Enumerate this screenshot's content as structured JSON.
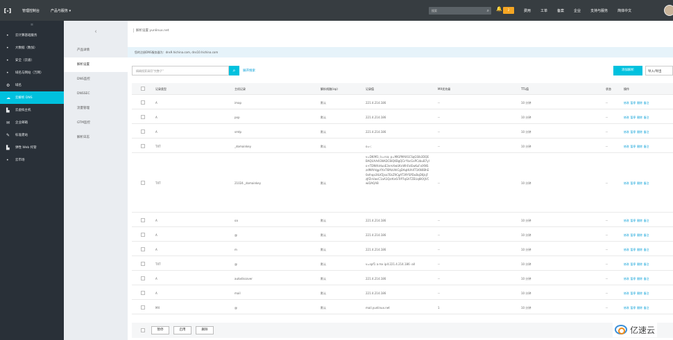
{
  "topbar": {
    "logo": "[-]",
    "console": "管理控制台",
    "products": "产品与服务 ▾",
    "search_placeholder": "搜索",
    "search_icon": "search-icon",
    "bell_icon": "bell-icon",
    "badge": "2",
    "links": [
      "费用",
      "工单",
      "备案",
      "企业",
      "支持与服务",
      "简体中文"
    ]
  },
  "sidebar": {
    "collapse": "≡",
    "items": [
      {
        "label": "云计算基础服务",
        "icon": "•"
      },
      {
        "label": "大数据（数加）",
        "icon": "•"
      },
      {
        "label": "安全（云盾）",
        "icon": "•"
      },
      {
        "label": "域名与网站（万网）",
        "icon": "•"
      },
      {
        "label": "域名",
        "icon": "⚙"
      },
      {
        "label": "云解析 DNS",
        "icon": "☁"
      },
      {
        "label": "云虚拟主机",
        "icon": "▙"
      },
      {
        "label": "企业邮箱",
        "icon": "✉"
      },
      {
        "label": "标准建站",
        "icon": "✎"
      },
      {
        "label": "弹性 Web 托管",
        "icon": "▙"
      },
      {
        "label": "云市场",
        "icon": "•"
      }
    ],
    "active_index": 5
  },
  "subnav": {
    "back": "‹",
    "items": [
      "产品详情",
      "解析设置",
      "DNS监控",
      "DNSSEC",
      "流量管理",
      "GTM监控",
      "解析日志"
    ],
    "active_index": 1
  },
  "main": {
    "breadcrumb": "解析设置 yunlinux.net",
    "notice": "您的注册DNS服务器为：dns9.hichina.com, dns10.hichina.com",
    "search_placeholder": "精确搜索请用\"完整子\"",
    "advanced": "展开搜索",
    "add_button": "添加解析",
    "import_button": "导入/导出"
  },
  "table": {
    "headers": [
      "记录类型",
      "主机记录",
      "解析线路(isp)",
      "记录值",
      "MX优先级",
      "TTL值",
      "状态",
      "操作"
    ],
    "ops": [
      "修改",
      "暂停",
      "删除",
      "备注"
    ],
    "rows": [
      {
        "type": "A",
        "host": "imap",
        "line": "默认",
        "value": "221.4.214.186",
        "mx": "--",
        "ttl": "10 分钟",
        "status": "--"
      },
      {
        "type": "A",
        "host": "pop",
        "line": "默认",
        "value": "221.4.214.186",
        "mx": "--",
        "ttl": "10 分钟",
        "status": "--"
      },
      {
        "type": "A",
        "host": "smtp",
        "line": "默认",
        "value": "221.4.214.186",
        "mx": "--",
        "ttl": "10 分钟",
        "status": "--"
      },
      {
        "type": "TXT",
        "host": "_domainkey",
        "line": "默认",
        "value": "o=-;",
        "mx": "--",
        "ttl": "10 分钟",
        "status": "--"
      },
      {
        "type": "TXT",
        "host": "21024._domainkey",
        "line": "默认",
        "value": "v=DKIM1; k=rsa; p=MIGfMA0GCSqGSIb3DQEBAQUAA4GNADCBiQKBgQCirYbcGxPCzbuB7yIo+TDNtfoHuoE3nmXwUKnWhFolEwKuFxIXNSzdMAYdgpYXnT6MzUhICgDAqHUhXT1KN0BhE0ofnqo3tLK5Jxa7EkZ9CgAT39YSPDuBqD6jkjFzJfZnVwcC1aA1QzrKn6iTrP7qGhTZEUq6KXJVCwiDAQAB",
        "mx": "--",
        "ttl": "10 分钟",
        "status": "--"
      },
      {
        "type": "A",
        "host": "oa",
        "line": "默认",
        "value": "221.4.214.186",
        "mx": "--",
        "ttl": "10 分钟",
        "status": "--"
      },
      {
        "type": "A",
        "host": "@",
        "line": "默认",
        "value": "221.4.214.186",
        "mx": "--",
        "ttl": "10 分钟",
        "status": "--"
      },
      {
        "type": "A",
        "host": "m",
        "line": "默认",
        "value": "221.4.214.186",
        "mx": "--",
        "ttl": "10 分钟",
        "status": "--"
      },
      {
        "type": "TXT",
        "host": "@",
        "line": "默认",
        "value": "v=spf1 a mx ip4:221.4.214.186 -all",
        "mx": "--",
        "ttl": "10 分钟",
        "status": "--"
      },
      {
        "type": "A",
        "host": "autodiscover",
        "line": "默认",
        "value": "221.4.214.186",
        "mx": "--",
        "ttl": "10 分钟",
        "status": "--"
      },
      {
        "type": "A",
        "host": "mail",
        "line": "默认",
        "value": "221.4.214.186",
        "mx": "--",
        "ttl": "10 分钟",
        "status": "--"
      },
      {
        "type": "MX",
        "host": "@",
        "line": "默认",
        "value": "mail.yunlinux.net",
        "mx": "1",
        "ttl": "10 分钟",
        "status": "--"
      }
    ]
  },
  "footer": {
    "buttons": [
      "暂停",
      "启用",
      "删除"
    ]
  },
  "watermark": "亿速云",
  "colors": {
    "topbar": "#373d41",
    "sidebar": "#293038",
    "accent": "#00c1de",
    "link": "#0aa0d8"
  }
}
